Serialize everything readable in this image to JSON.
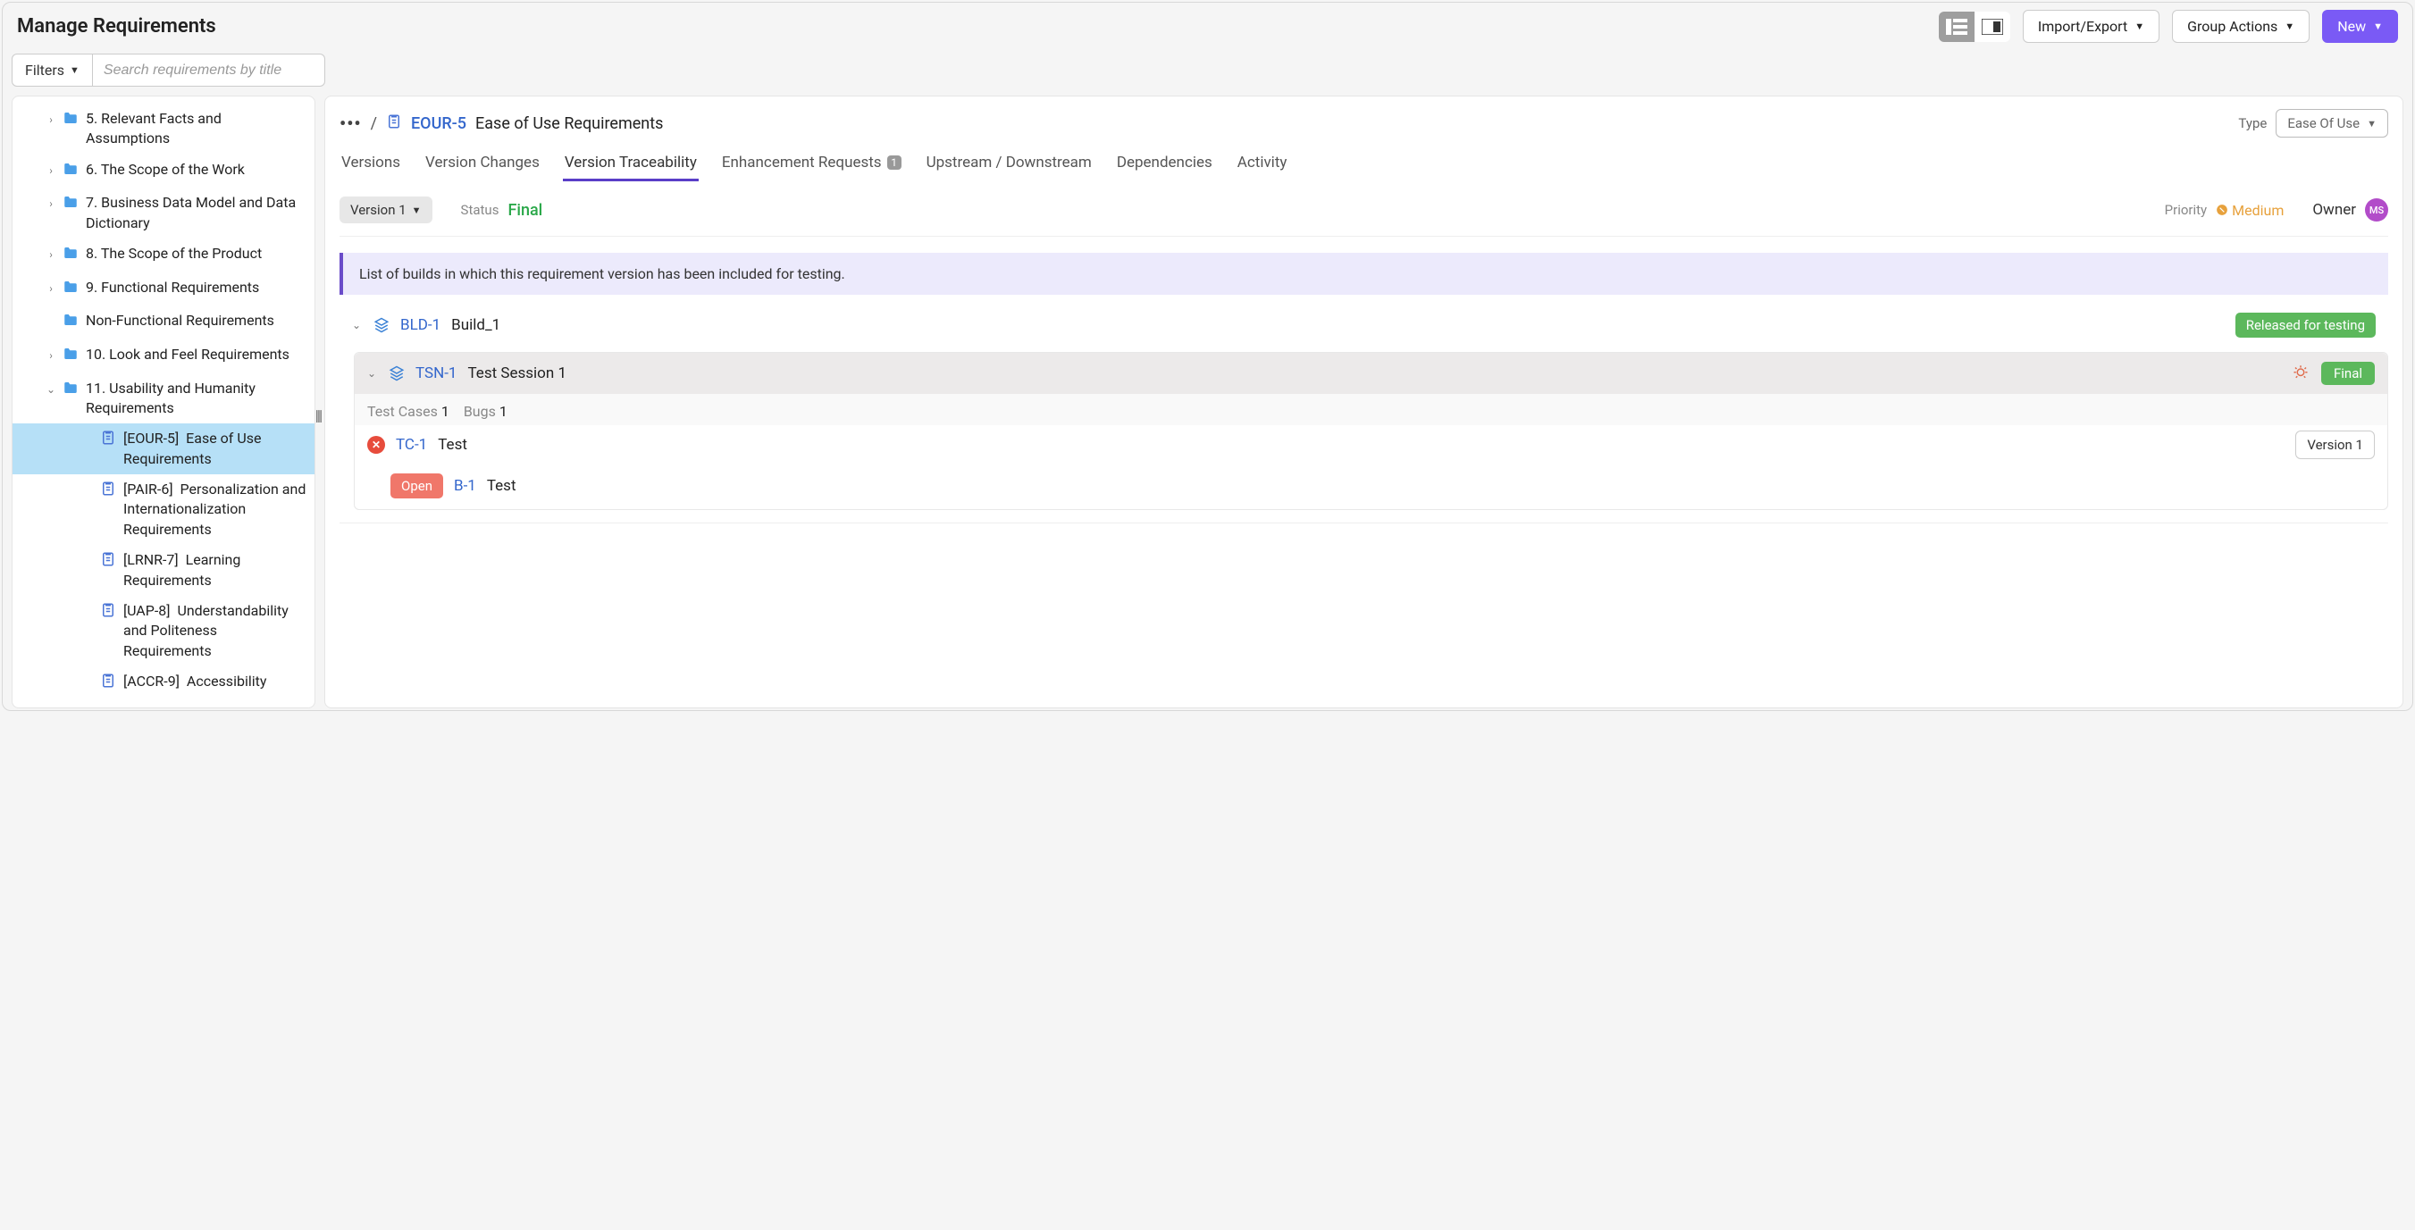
{
  "header": {
    "title": "Manage Requirements",
    "import_export": "Import/Export",
    "group_actions": "Group Actions",
    "new": "New"
  },
  "filter": {
    "label": "Filters",
    "search_placeholder": "Search requirements by title"
  },
  "sidebar": {
    "items": [
      {
        "depth": 1,
        "chev": "›",
        "icon": "folder",
        "label": "5. Relevant Facts and Assumptions"
      },
      {
        "depth": 1,
        "chev": "›",
        "icon": "folder",
        "label": "6. The Scope of the Work"
      },
      {
        "depth": 1,
        "chev": "›",
        "icon": "folder",
        "label": "7. Business Data Model and Data Dictionary"
      },
      {
        "depth": 1,
        "chev": "›",
        "icon": "folder",
        "label": "8. The Scope of the Product"
      },
      {
        "depth": 1,
        "chev": "›",
        "icon": "folder",
        "label": "9. Functional Requirements"
      },
      {
        "depth": 1,
        "chev": "",
        "icon": "folder",
        "label": "Non-Functional Requirements"
      },
      {
        "depth": 1,
        "chev": "›",
        "icon": "folder",
        "label": "10. Look and Feel Requirements"
      },
      {
        "depth": 1,
        "chev": "⌄",
        "icon": "folder",
        "label": "11. Usability and Humanity Requirements"
      },
      {
        "depth": 3,
        "chev": "",
        "icon": "item",
        "selected": true,
        "code": "[EOUR-5]",
        "label": "Ease of Use Requirements"
      },
      {
        "depth": 3,
        "chev": "",
        "icon": "item",
        "code": "[PAIR-6]",
        "label": "Personalization and Internationalization Requirements"
      },
      {
        "depth": 3,
        "chev": "",
        "icon": "item",
        "code": "[LRNR-7]",
        "label": "Learning Requirements"
      },
      {
        "depth": 3,
        "chev": "",
        "icon": "item",
        "code": "[UAP-8]",
        "label": "Understandability and Politeness Requirements"
      },
      {
        "depth": 3,
        "chev": "",
        "icon": "item",
        "code": "[ACCR-9]",
        "label": "Accessibility"
      }
    ]
  },
  "detail": {
    "crumb": {
      "id": "EOUR-5",
      "title": "Ease of Use Requirements"
    },
    "type_label": "Type",
    "type_value": "Ease Of Use",
    "tabs": [
      {
        "label": "Versions"
      },
      {
        "label": "Version Changes"
      },
      {
        "label": "Version Traceability",
        "active": true
      },
      {
        "label": "Enhancement Requests",
        "badge": "1"
      },
      {
        "label": "Upstream / Downstream"
      },
      {
        "label": "Dependencies"
      },
      {
        "label": "Activity"
      }
    ],
    "version_btn": "Version 1",
    "status_label": "Status",
    "status_value": "Final",
    "priority_label": "Priority",
    "priority_value": "Medium",
    "owner_label": "Owner",
    "owner_initials": "MS",
    "info_banner": "List of builds in which this requirement version has been included for testing.",
    "build": {
      "id": "BLD-1",
      "name": "Build_1",
      "status": "Released for testing"
    },
    "session": {
      "id": "TSN-1",
      "name": "Test Session 1",
      "status": "Final"
    },
    "counts": {
      "tc_label": "Test Cases",
      "tc_count": "1",
      "bug_label": "Bugs",
      "bug_count": "1"
    },
    "testcase": {
      "id": "TC-1",
      "name": "Test",
      "version": "Version 1"
    },
    "bug": {
      "status": "Open",
      "id": "B-1",
      "name": "Test"
    }
  }
}
